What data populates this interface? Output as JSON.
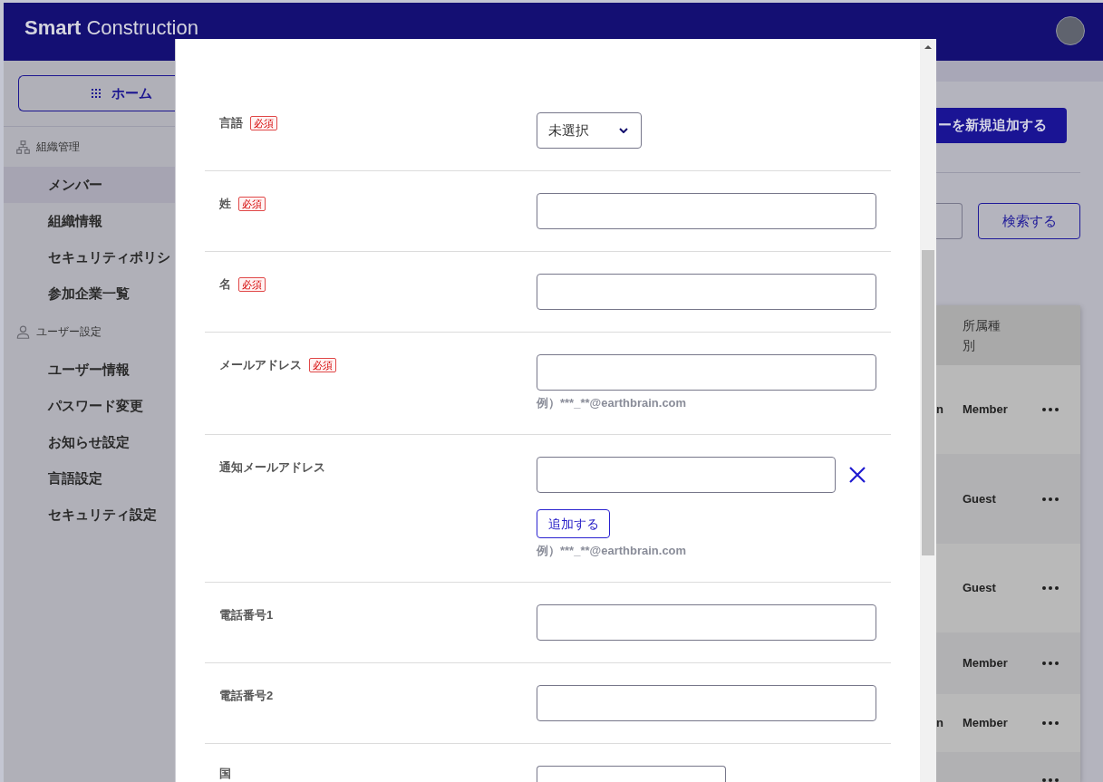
{
  "header": {
    "logo": "**Smart** Construction"
  },
  "sidebar": {
    "home_button": "ホーム",
    "sections": [
      {
        "kind": "organization",
        "title": "組織管理",
        "items": [
          {
            "label": "メンバー",
            "selected": true
          },
          {
            "label": "組織情報",
            "selected": false
          },
          {
            "label": "セキュリティポリシ",
            "selected": false
          },
          {
            "label": "参加企業一覧",
            "selected": false
          }
        ]
      },
      {
        "kind": "user",
        "title": "ユーザー設定",
        "items": [
          {
            "label": "ユーザー情報",
            "selected": false
          },
          {
            "label": "パスワード変更",
            "selected": false
          },
          {
            "label": "お知らせ設定",
            "selected": false
          },
          {
            "label": "言語設定",
            "selected": false
          },
          {
            "label": "セキュリティ設定",
            "selected": false
          }
        ]
      }
    ]
  },
  "main": {
    "add_button": "ーを新規追加する",
    "search_button": "検索する",
    "table": {
      "columns": [
        "所属種別"
      ],
      "rows": [
        {
          "column_1": "n",
          "affiliation": "Member"
        },
        {
          "affiliation": "Guest"
        },
        {
          "affiliation": "Guest"
        },
        {
          "affiliation": "Member"
        },
        {
          "column_1": "n",
          "affiliation": "Member"
        },
        {}
      ]
    }
  },
  "dialog": {
    "fields": [
      {
        "label": "言語",
        "badge": "必須",
        "kind": "select",
        "value": "未選択"
      },
      {
        "label": "姓",
        "badge": "必須",
        "kind": "text"
      },
      {
        "label": "名",
        "badge": "必須",
        "kind": "text"
      },
      {
        "label": "メールアドレス",
        "badge": "必須",
        "kind": "text",
        "hint": "例）***_**@earthbrain.com"
      },
      {
        "label": "通知メールアドレス",
        "kind": "multitext",
        "add_button": "追加する",
        "hint": "例）***_**@earthbrain.com"
      },
      {
        "label": "電話番号1",
        "kind": "text"
      },
      {
        "label": "電話番号2",
        "kind": "text"
      },
      {
        "label": "国",
        "kind": "wideselect"
      }
    ]
  }
}
